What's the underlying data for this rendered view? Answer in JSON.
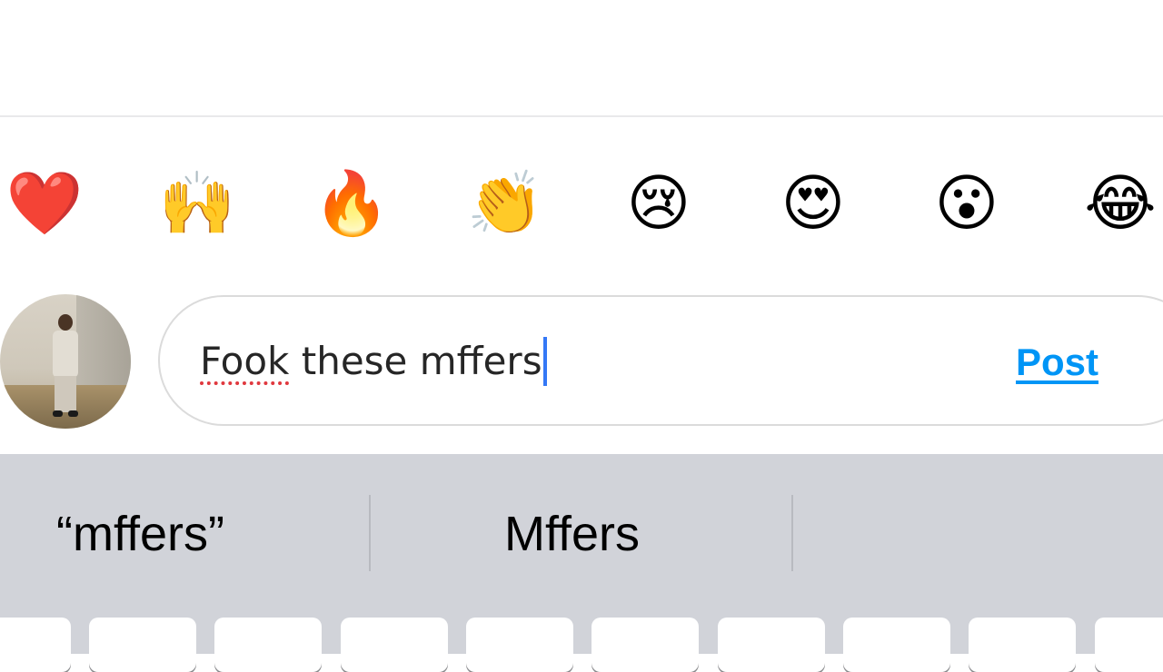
{
  "reactions": [
    {
      "emoji": "❤️",
      "name": "heart"
    },
    {
      "emoji": "🙌",
      "name": "raising-hands"
    },
    {
      "emoji": "🔥",
      "name": "fire"
    },
    {
      "emoji": "👏",
      "name": "clapping-hands"
    },
    {
      "emoji": "😢",
      "name": "crying-face"
    },
    {
      "emoji": "😍",
      "name": "heart-eyes"
    },
    {
      "emoji": "😮",
      "name": "surprised-face"
    },
    {
      "emoji": "😂",
      "name": "tears-of-joy"
    }
  ],
  "comment": {
    "word1": "Fook",
    "rest": " these mffers",
    "post_label": "Post"
  },
  "keyboard": {
    "suggestions": [
      "“mffers”",
      "Mffers",
      ""
    ]
  },
  "colors": {
    "post_blue": "#0095f6",
    "caret_blue": "#3478f6",
    "keyboard_bg": "#d1d3d9"
  }
}
